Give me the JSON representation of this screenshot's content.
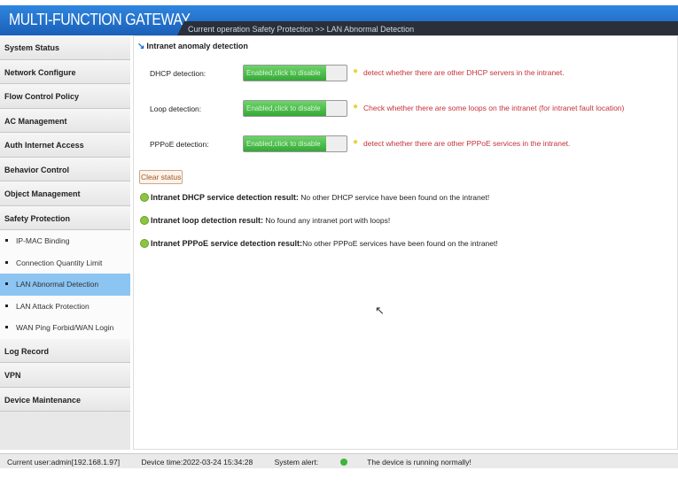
{
  "header": {
    "title": "MULTI-FUNCTION GATEWAY",
    "breadcrumb": "Current operation  Safety Protection >> LAN Abnormal Detection"
  },
  "sidebar": {
    "top": [
      "System Status",
      "Network Configure",
      "Flow Control Policy",
      "AC Management",
      "Auth Internet Access",
      "Behavior Control",
      "Object Management",
      "Safety Protection"
    ],
    "sub": [
      "IP-MAC Binding",
      "Connection Quantity Limit",
      "LAN Abnormal Detection",
      "LAN Attack Protection",
      "WAN Ping Forbid/WAN Login"
    ],
    "bottom": [
      "Log Record",
      "VPN",
      "Device Maintenance"
    ]
  },
  "content": {
    "title": "Intranet anomaly detection",
    "rows": [
      {
        "label": "DHCP detection:",
        "toggle": "Enabled,click to disable",
        "hint": "detect whether there are other DHCP servers in the intranet."
      },
      {
        "label": "Loop detection:",
        "toggle": "Enabled,click to disable",
        "hint": "Check whether there are some loops on the intranet (for intranet fault location)"
      },
      {
        "label": "PPPoE detection:",
        "toggle": "Enabled,click to disable",
        "hint": "detect whether there are other PPPoE services in the intranet."
      }
    ],
    "clear_label": "Clear status",
    "results": [
      {
        "label": "Intranet DHCP service detection result:",
        "text": " No other DHCP service have been found on the intranet!"
      },
      {
        "label": "Intranet loop detection result:",
        "text": " No found any intranet port with loops!"
      },
      {
        "label": "Intranet PPPoE service detection result:",
        "text": "No other PPPoE services have been found on the intranet!"
      }
    ]
  },
  "status": {
    "user": "Current user:admin[192.168.1.97]",
    "time": "Device time:2022-03-24 15:34:28",
    "alert_label": "System alert:",
    "alert_text": "The device is running normally!"
  }
}
